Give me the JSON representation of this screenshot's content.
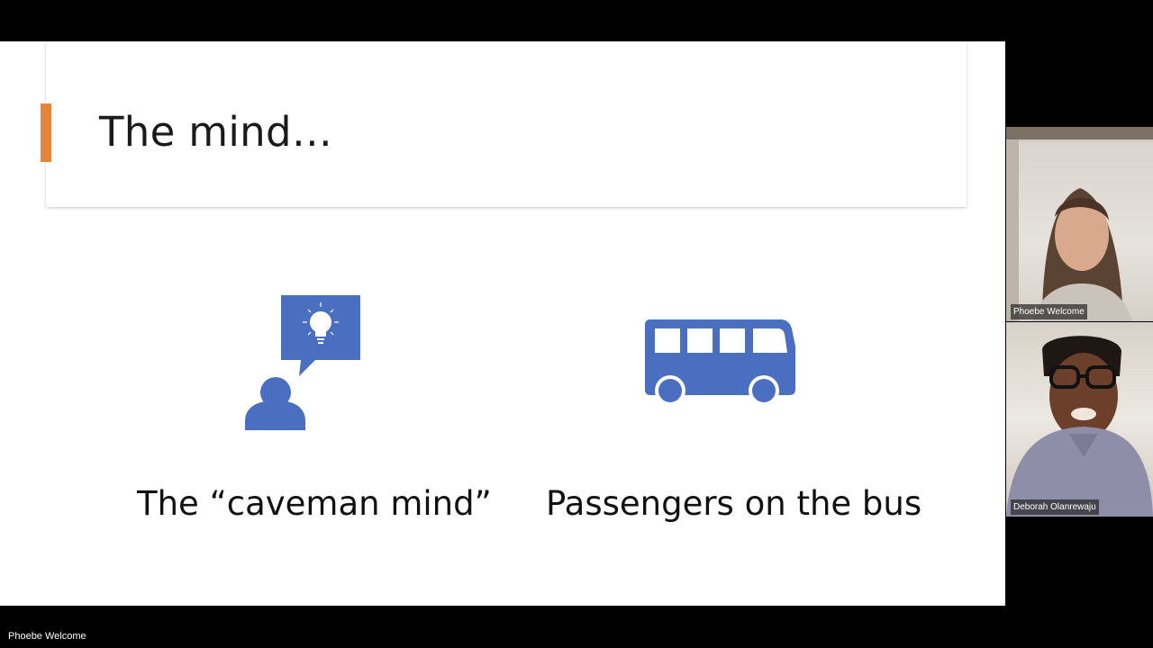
{
  "slide": {
    "title": "The mind…",
    "left_caption": "The “caveman mind”",
    "right_caption": "Passengers on the bus",
    "accent_color": "#E8833A",
    "icon_color": "#4A6FC1"
  },
  "participants": [
    {
      "name": "Phoebe Welcome",
      "icon": "video-tile"
    },
    {
      "name": "Deborah Olanrewaju",
      "icon": "video-tile"
    }
  ],
  "bottom_bar": {
    "active_speaker_name": "Phoebe Welcome"
  }
}
